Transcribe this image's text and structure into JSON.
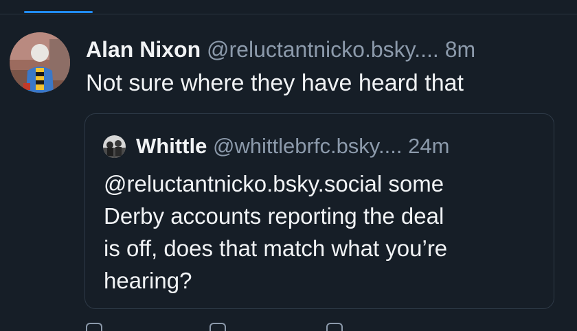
{
  "post": {
    "author_name": "Alan Nixon",
    "author_handle": "@reluctantnicko.bsky....",
    "time": "8m",
    "text": "Not sure where they have heard that"
  },
  "quoted_post": {
    "author_name": "Whittle",
    "author_handle": "@whittlebrfc.bsky....",
    "time": "24m",
    "text_lines": [
      "@reluctantnicko.bsky.social some",
      "Derby accounts reporting the deal",
      "is off, does that match what you’re",
      "hearing?"
    ]
  },
  "colors": {
    "background": "#161e27",
    "text": "#f1f3f5",
    "muted": "#8c9aab",
    "accent": "#208bfe",
    "border": "#2e3a47"
  },
  "icons": {
    "actions": [
      "reply-icon",
      "repost-icon",
      "like-icon"
    ]
  }
}
